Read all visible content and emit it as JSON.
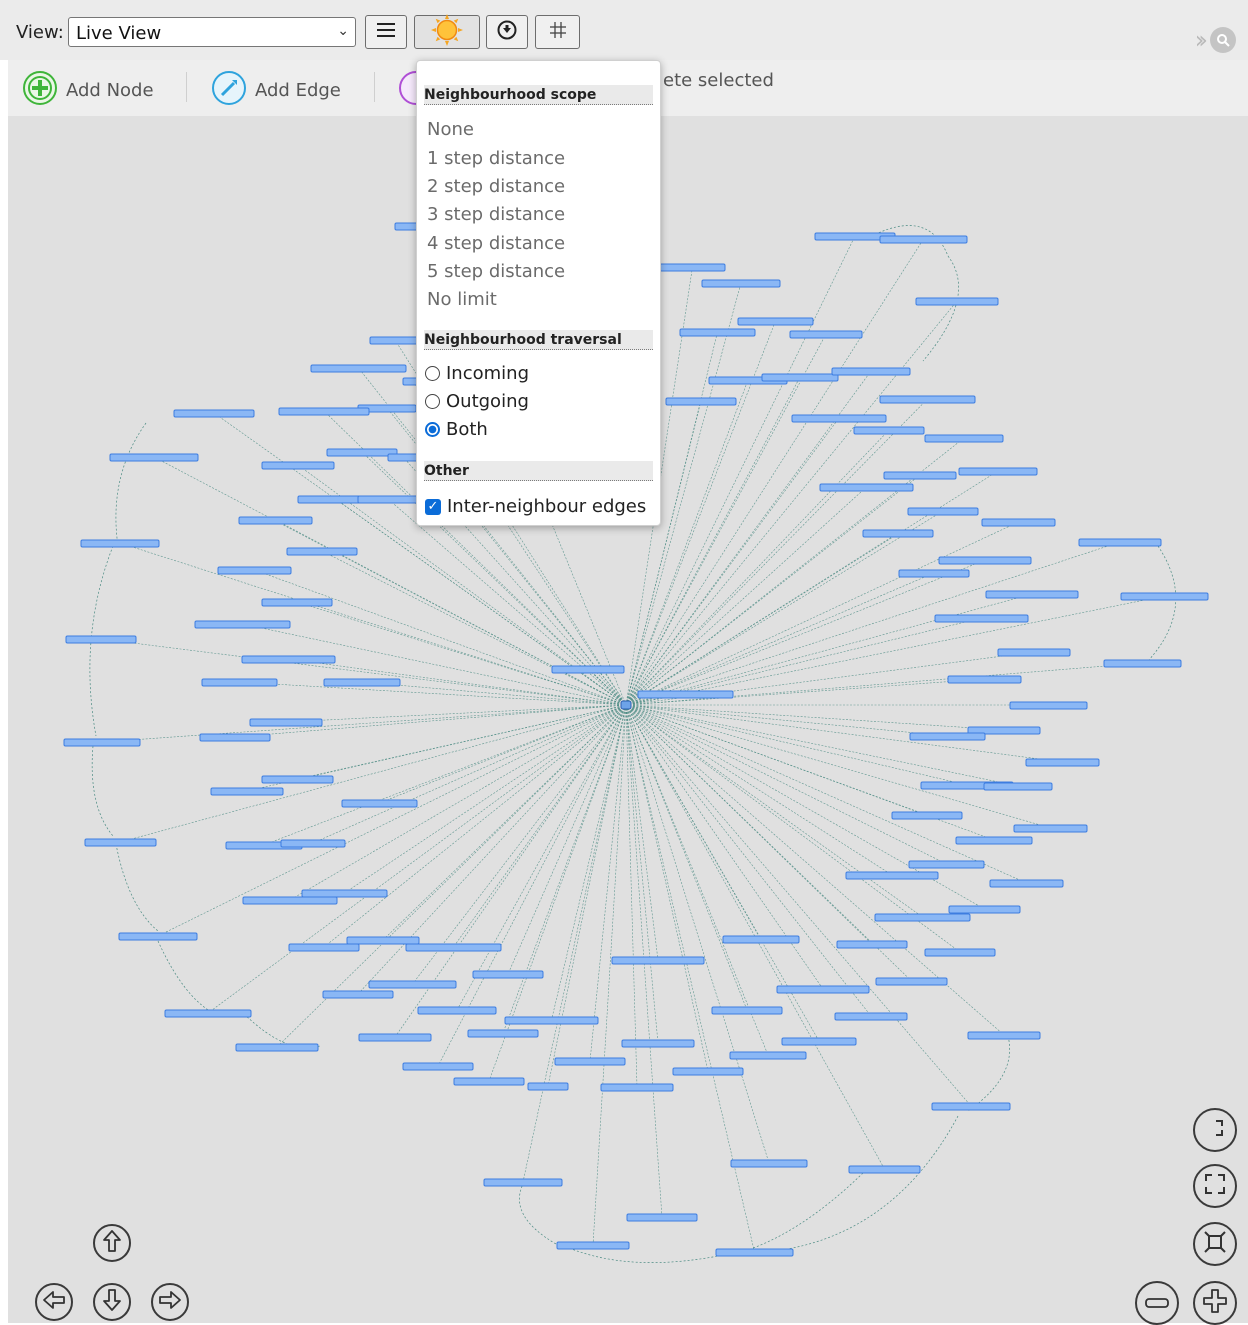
{
  "topbar": {
    "view_label": "View:",
    "view_value": "Live View",
    "chevron": "chevron-down",
    "buttons": [
      "menu-icon",
      "sun-icon",
      "download-circle-icon",
      "grid-icon"
    ],
    "right_icons": [
      "double-chevron-right-icon",
      "search-icon"
    ]
  },
  "toolbar": {
    "add_node": "Add Node",
    "add_edge": "Add Edge",
    "delete_selected": "ete selected"
  },
  "popup": {
    "scope_title": "Neighbourhood scope",
    "scope_options": [
      "None",
      "1 step distance",
      "2 step distance",
      "3 step distance",
      "4 step distance",
      "5 step distance",
      "No limit"
    ],
    "traversal_title": "Neighbourhood traversal",
    "traversal_options": [
      "Incoming",
      "Outgoing",
      "Both"
    ],
    "traversal_selected": "Both",
    "other_title": "Other",
    "inter_neighbour": "Inter-neighbour edges",
    "inter_neighbour_checked": true
  },
  "graph": {
    "node_color": "#8ab7f5",
    "node_border": "#3d7de0",
    "edge_color": "#4a8a82",
    "hub_color": "#6da3e8"
  },
  "controls": {
    "nav": [
      "arrow-up-icon",
      "arrow-left-icon",
      "arrow-down-icon",
      "arrow-right-icon"
    ],
    "view": [
      "fit-icon",
      "fullscreen-icon",
      "frame-icon",
      "zoom-out-icon",
      "zoom-in-icon"
    ]
  }
}
